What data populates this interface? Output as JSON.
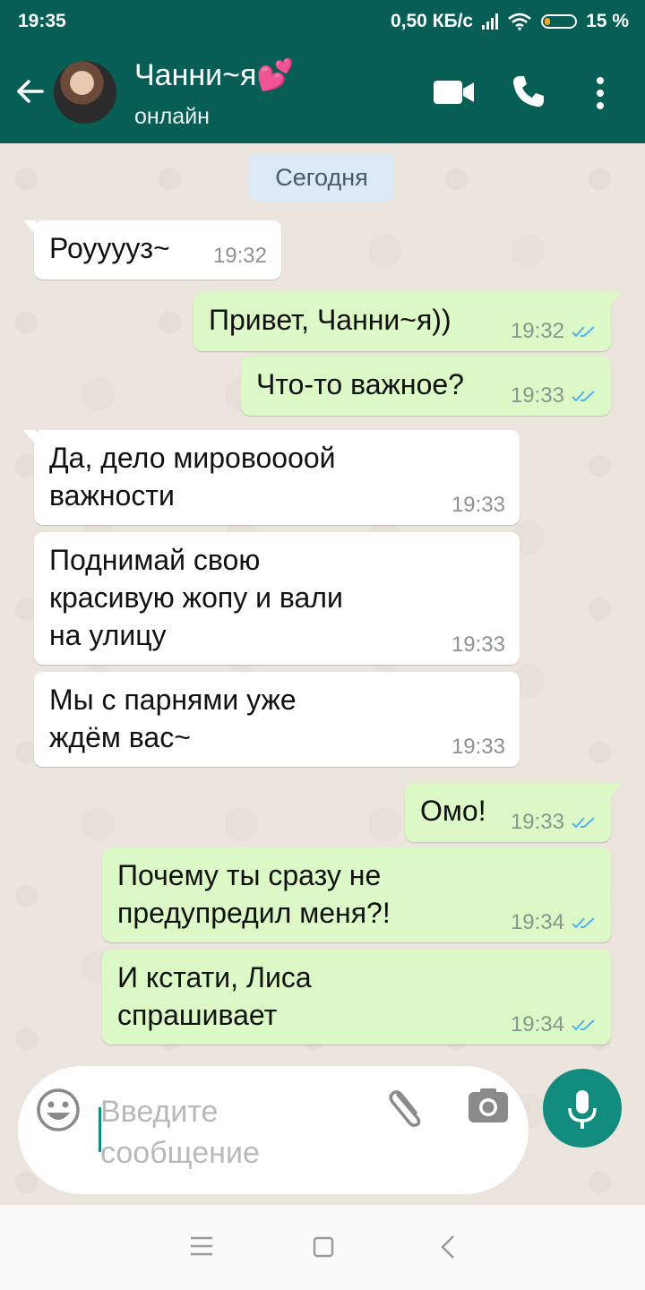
{
  "status_bar": {
    "time": "19:35",
    "speed": "0,50 КБ/с",
    "battery": "15 %"
  },
  "header": {
    "name": "Чанни~я💕",
    "status": "онлайн"
  },
  "chat": {
    "date_label": "Сегодня",
    "messages": [
      {
        "dir": "in",
        "text": "Роууууз~",
        "time": "19:32"
      },
      {
        "dir": "out",
        "text": "Привет, Чанни~я))",
        "time": "19:32"
      },
      {
        "dir": "out",
        "text": "Что-то важное?",
        "time": "19:33"
      },
      {
        "dir": "in",
        "text": "Да, дело мировоооой\nважности",
        "time": "19:33"
      },
      {
        "dir": "in",
        "text": "Поднимай свою\nкрасивую жопу и вали\nна улицу",
        "time": "19:33"
      },
      {
        "dir": "in",
        "text": "Мы с парнями уже\nждём вас~",
        "time": "19:33"
      },
      {
        "dir": "out",
        "text": "Омо!",
        "time": "19:33"
      },
      {
        "dir": "out",
        "text": "Почему ты сразу не\nпредупредил меня?!",
        "time": "19:34"
      },
      {
        "dir": "out",
        "text": "И кстати, Лиса\nспрашивает",
        "time": "19:34"
      }
    ]
  },
  "composer": {
    "placeholder": "Введите\nсообщение"
  },
  "colors": {
    "header": "#075e54",
    "accent": "#128c7e",
    "outgoing": "#dcf8c6",
    "incoming": "#ffffff",
    "tick": "#4fb3f6"
  }
}
